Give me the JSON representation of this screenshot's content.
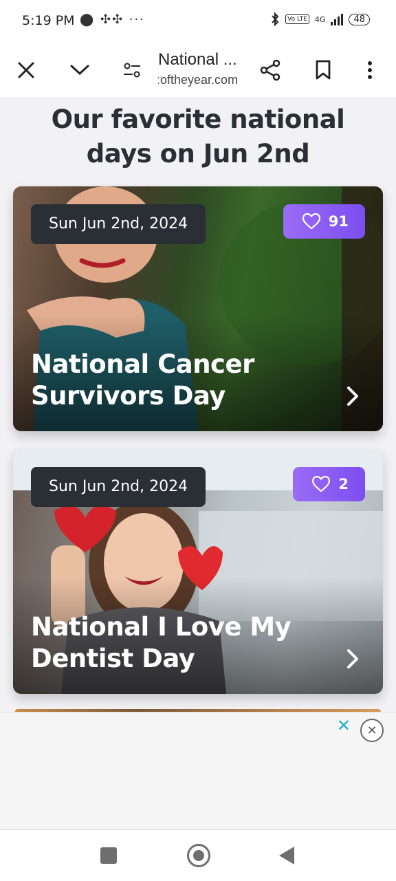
{
  "status_bar": {
    "time": "5:19 PM",
    "notification_icons": "⬤ ✣✣ ···",
    "network": "4G",
    "volte": "Vo LTE",
    "battery": "48"
  },
  "browser": {
    "page_title": "National ...",
    "url": "ːoftheyear.com"
  },
  "heading": "Our favorite national days on Jun 2nd",
  "cards": [
    {
      "date": "Sun Jun 2nd, 2024",
      "likes": "91",
      "title": "National Cancer Survivors Day"
    },
    {
      "date": "Sun Jun 2nd, 2024",
      "likes": "2",
      "title": "National I Love My Dentist Day"
    }
  ],
  "ad": {
    "ad_choice": "✕",
    "close": "✕"
  },
  "colors": {
    "like_pill": "#8a5cf5",
    "date_pill": "#2a2f36",
    "heading": "#2a2f36"
  }
}
